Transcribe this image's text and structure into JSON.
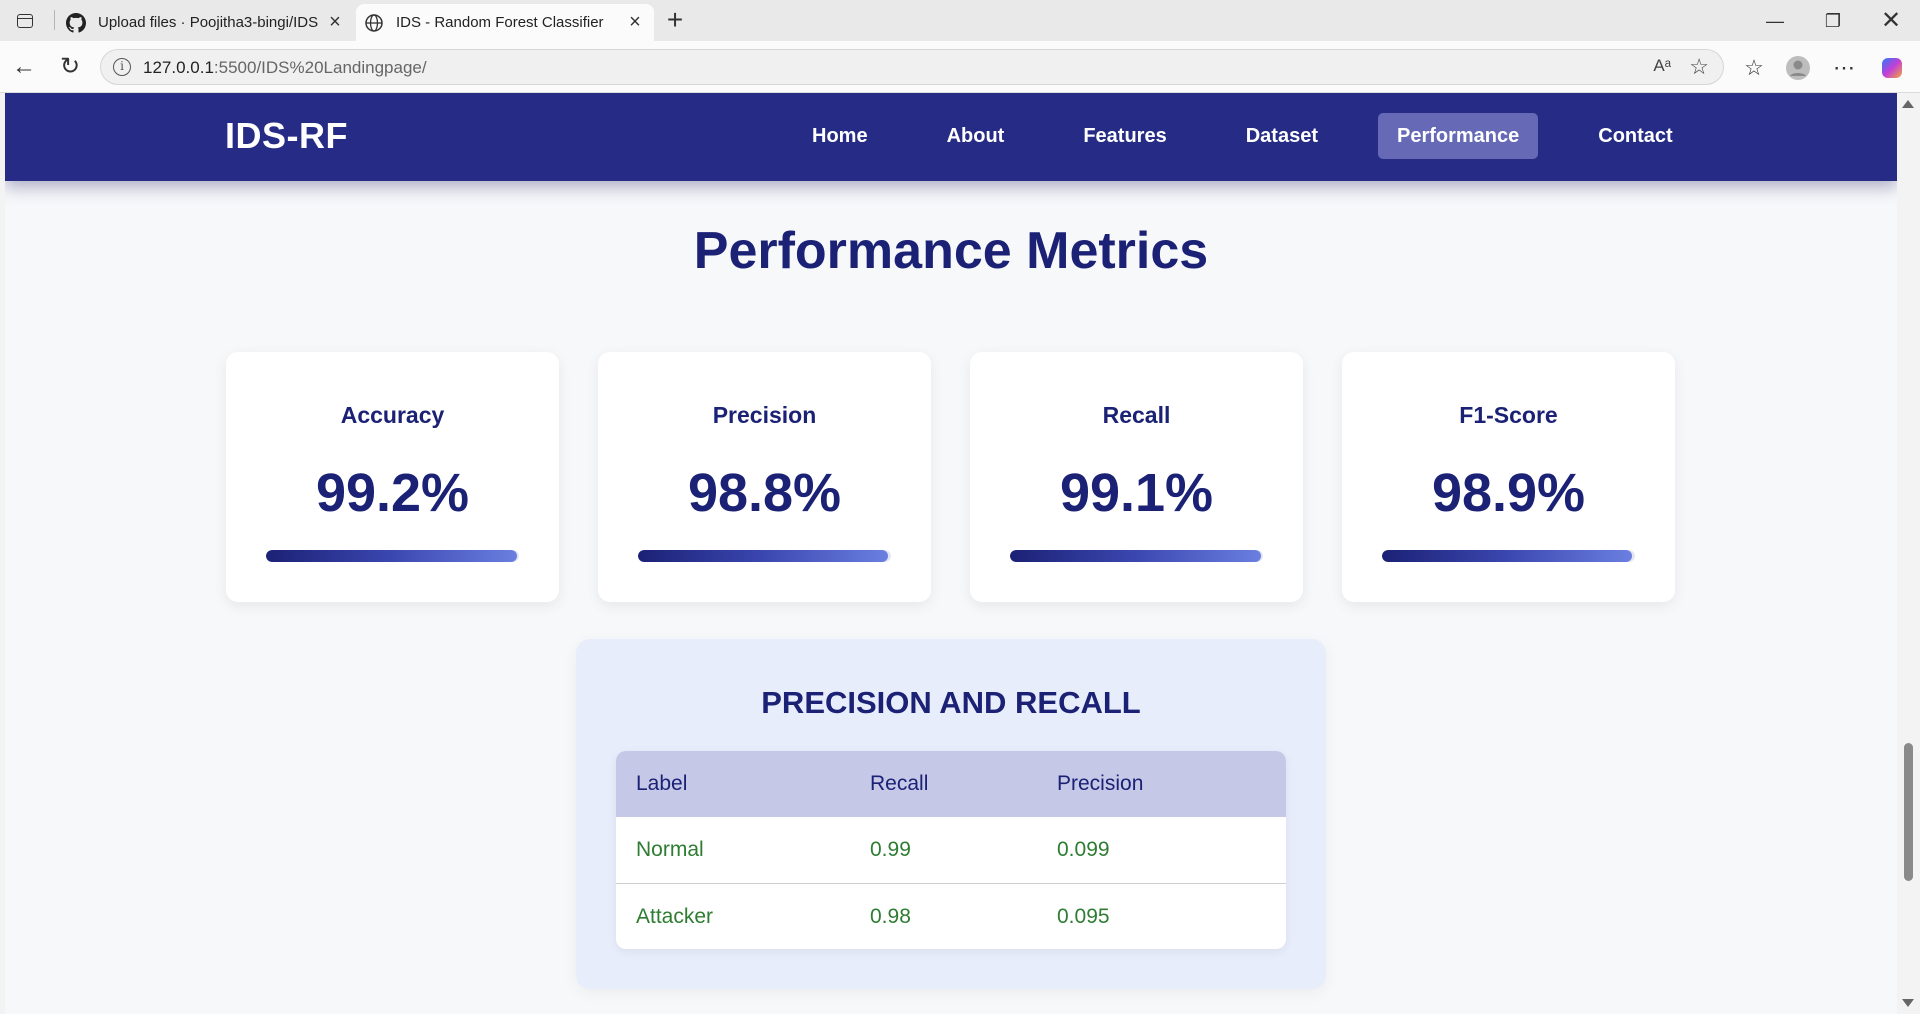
{
  "browser": {
    "tabs": [
      {
        "title": "Upload files · Poojitha3-bingi/IDS",
        "active": false,
        "icon": "github-icon"
      },
      {
        "title": "IDS - Random Forest Classifier",
        "active": true,
        "icon": "globe-icon"
      }
    ],
    "url_host": "127.0.0.1",
    "url_rest": ":5500/IDS%20Landingpage/"
  },
  "navbar": {
    "brand": "IDS-RF",
    "links": [
      {
        "label": "Home",
        "active": false
      },
      {
        "label": "About",
        "active": false
      },
      {
        "label": "Features",
        "active": false
      },
      {
        "label": "Dataset",
        "active": false
      },
      {
        "label": "Performance",
        "active": true
      },
      {
        "label": "Contact",
        "active": false
      }
    ]
  },
  "performance": {
    "title": "Performance Metrics",
    "metrics": [
      {
        "label": "Accuracy",
        "value": "99.2%",
        "progress": 0.992
      },
      {
        "label": "Precision",
        "value": "98.8%",
        "progress": 0.988
      },
      {
        "label": "Recall",
        "value": "99.1%",
        "progress": 0.991
      },
      {
        "label": "F1-Score",
        "value": "98.9%",
        "progress": 0.989
      }
    ]
  },
  "pr_table": {
    "title": "PRECISION AND RECALL",
    "headers": [
      "Label",
      "Recall",
      "Precision"
    ],
    "rows": [
      [
        "Normal",
        "0.99",
        "0.099"
      ],
      [
        "Attacker",
        "0.98",
        "0.095"
      ]
    ]
  },
  "colors": {
    "navbar_bg": "#262c86",
    "nav_active_bg": "#6569b6",
    "heading": "#1b2175",
    "table_value": "#2e7d32"
  }
}
